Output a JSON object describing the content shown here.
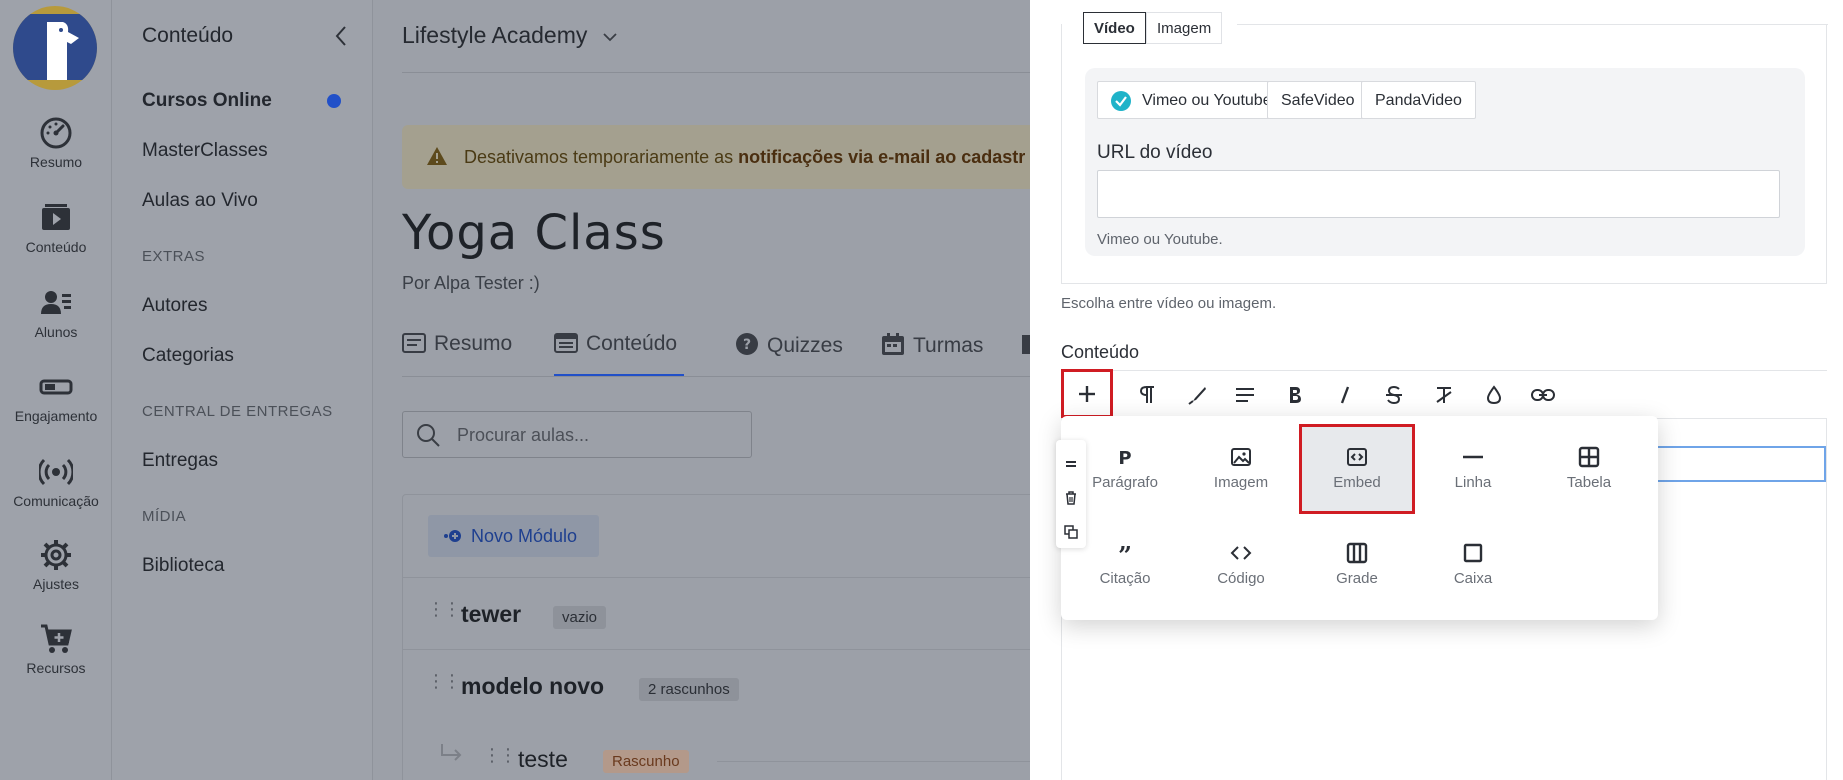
{
  "rail": {
    "items": [
      {
        "label": "Resumo",
        "icon": "dashboard-gauge-icon"
      },
      {
        "label": "Conteúdo",
        "icon": "video-play-icon"
      },
      {
        "label": "Alunos",
        "icon": "users-list-icon"
      },
      {
        "label": "Engajamento",
        "icon": "toggle-icon"
      },
      {
        "label": "Comunicação",
        "icon": "broadcast-icon"
      },
      {
        "label": "Ajustes",
        "icon": "gear-icon"
      },
      {
        "label": "Recursos",
        "icon": "cart-plus-icon"
      }
    ]
  },
  "sidebar": {
    "title": "Conteúdo",
    "items": [
      {
        "label": "Cursos Online"
      },
      {
        "label": "MasterClasses"
      },
      {
        "label": "Aulas ao Vivo"
      }
    ],
    "extras_head": "EXTRAS",
    "extras": [
      {
        "label": "Autores"
      },
      {
        "label": "Categorias"
      }
    ],
    "deliveries_head": "CENTRAL DE ENTREGAS",
    "deliveries": [
      {
        "label": "Entregas"
      }
    ],
    "media_head": "MÍDIA",
    "media": [
      {
        "label": "Biblioteca"
      }
    ]
  },
  "main": {
    "org_name": "Lifestyle Academy",
    "alert_prefix": "Desativamos temporariamente as ",
    "alert_bold": "notificações via e-mail ao cadastr",
    "course_title": "Yoga Class",
    "course_author": "Por Alpa Tester :)",
    "tabs": [
      {
        "label": "Resumo"
      },
      {
        "label": "Conteúdo"
      },
      {
        "label": "Quizzes"
      },
      {
        "label": "Turmas"
      }
    ],
    "search_placeholder": "Procurar aulas...",
    "new_module_label": "Novo Módulo",
    "modules": [
      {
        "name": "tewer",
        "badge": "vazio"
      },
      {
        "name": "modelo novo",
        "badge": "2 rascunhos"
      }
    ],
    "lesson": {
      "name": "teste",
      "badge": "Rascunho"
    }
  },
  "drawer": {
    "media_tabs": [
      {
        "label": "Vídeo"
      },
      {
        "label": "Imagem"
      }
    ],
    "providers": [
      {
        "label": "Vimeo ou Youtube"
      },
      {
        "label": "SafeVideo"
      },
      {
        "label": "PandaVideo"
      }
    ],
    "url_label": "URL do vídeo",
    "url_value": "",
    "url_hint": "Vimeo ou Youtube.",
    "media_help": "Escolha entre vídeo ou imagem.",
    "content_label": "Conteúdo",
    "blocks": [
      {
        "label": "Parágrafo",
        "icon": "paragraph-p-icon"
      },
      {
        "label": "Imagem",
        "icon": "image-icon"
      },
      {
        "label": "Embed",
        "icon": "embed-code-icon"
      },
      {
        "label": "Linha",
        "icon": "horizontal-line-icon"
      },
      {
        "label": "Tabela",
        "icon": "table-icon"
      },
      {
        "label": "Citação",
        "icon": "quote-icon"
      },
      {
        "label": "Código",
        "icon": "code-icon"
      },
      {
        "label": "Grade",
        "icon": "grid-columns-icon"
      },
      {
        "label": "Caixa",
        "icon": "box-icon"
      }
    ]
  },
  "colors": {
    "accent": "#2150c8",
    "highlight_border": "#d01c23",
    "check": "#1fb3c9"
  }
}
